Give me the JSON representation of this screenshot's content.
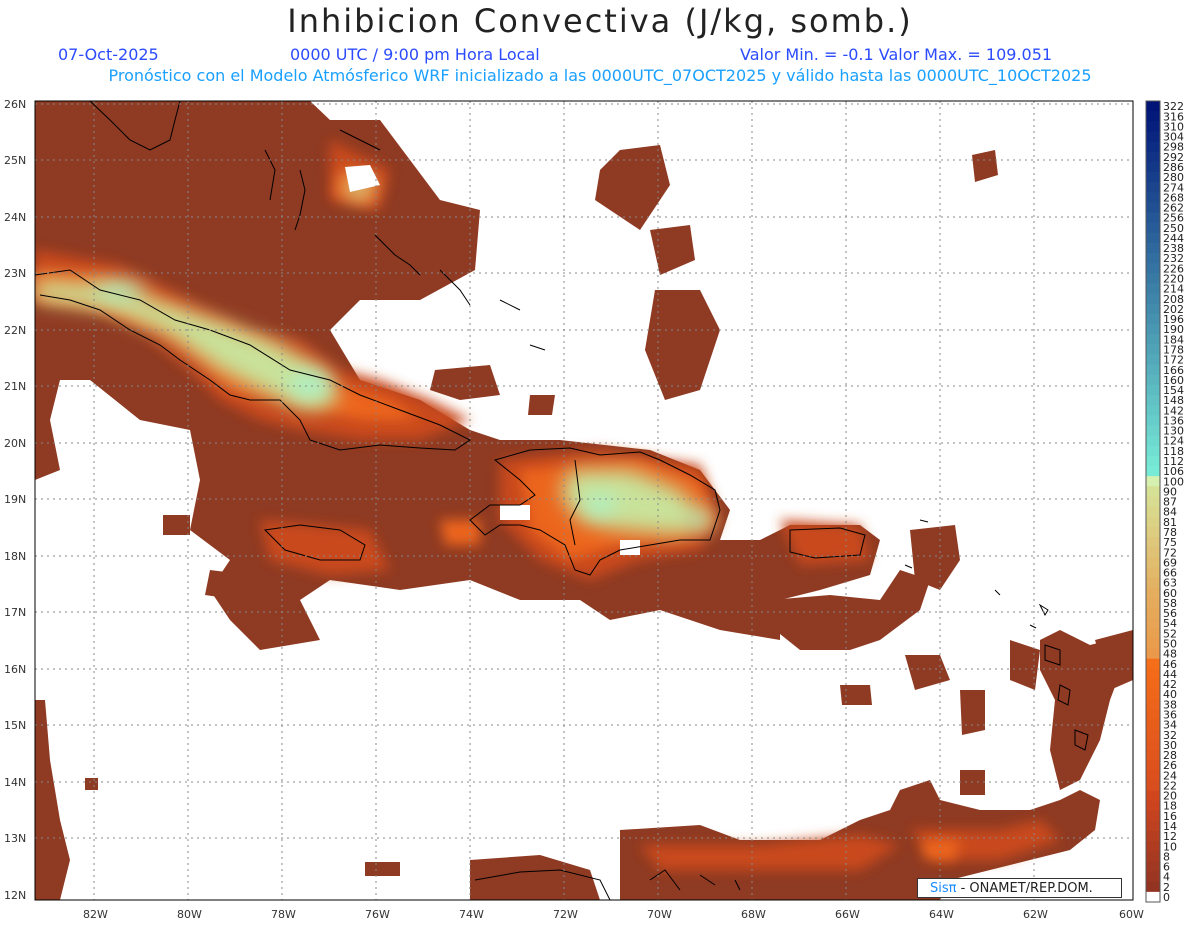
{
  "title": "Inhibicion Convectiva (J/kg, somb.)",
  "header": {
    "date": "07-Oct-2025",
    "time": "0000 UTC / 9:00 pm Hora Local",
    "minmax": "Valor Min. = -0.1  Valor Max. = 109.051"
  },
  "subtitle": "Pronóstico con el Modelo Atmósferico WRF inicializado a las 0000UTC_07OCT2025 y válido hasta las  0000UTC_10OCT2025",
  "lat_labels": [
    "26N",
    "25N",
    "24N",
    "23N",
    "22N",
    "21N",
    "20N",
    "19N",
    "18N",
    "17N",
    "16N",
    "15N",
    "14N",
    "13N",
    "12N"
  ],
  "lon_labels": [
    "82W",
    "80W",
    "78W",
    "76W",
    "74W",
    "72W",
    "70W",
    "68W",
    "66W",
    "64W",
    "62W",
    "60W"
  ],
  "colorbar": {
    "labels": [
      "322",
      "316",
      "310",
      "304",
      "298",
      "292",
      "286",
      "280",
      "274",
      "268",
      "262",
      "256",
      "250",
      "244",
      "238",
      "232",
      "226",
      "220",
      "214",
      "208",
      "202",
      "196",
      "190",
      "184",
      "178",
      "172",
      "166",
      "160",
      "154",
      "148",
      "142",
      "136",
      "130",
      "124",
      "118",
      "112",
      "106",
      "100",
      "90",
      "87",
      "84",
      "81",
      "78",
      "75",
      "72",
      "69",
      "66",
      "63",
      "60",
      "58",
      "56",
      "54",
      "52",
      "50",
      "48",
      "46",
      "44",
      "42",
      "40",
      "38",
      "36",
      "34",
      "32",
      "30",
      "28",
      "26",
      "24",
      "22",
      "20",
      "18",
      "16",
      "14",
      "12",
      "10",
      "8",
      "6",
      "4",
      "2",
      "0"
    ]
  },
  "credit": {
    "logo": "Sisπ",
    "text": " - ONAMET/REP.DOM."
  },
  "colors": {
    "base": "#8f3a22",
    "mid": "#d14f1c",
    "orange": "#ef6a1a",
    "light": "#c8e59a",
    "peak": "#a9f2c4"
  }
}
